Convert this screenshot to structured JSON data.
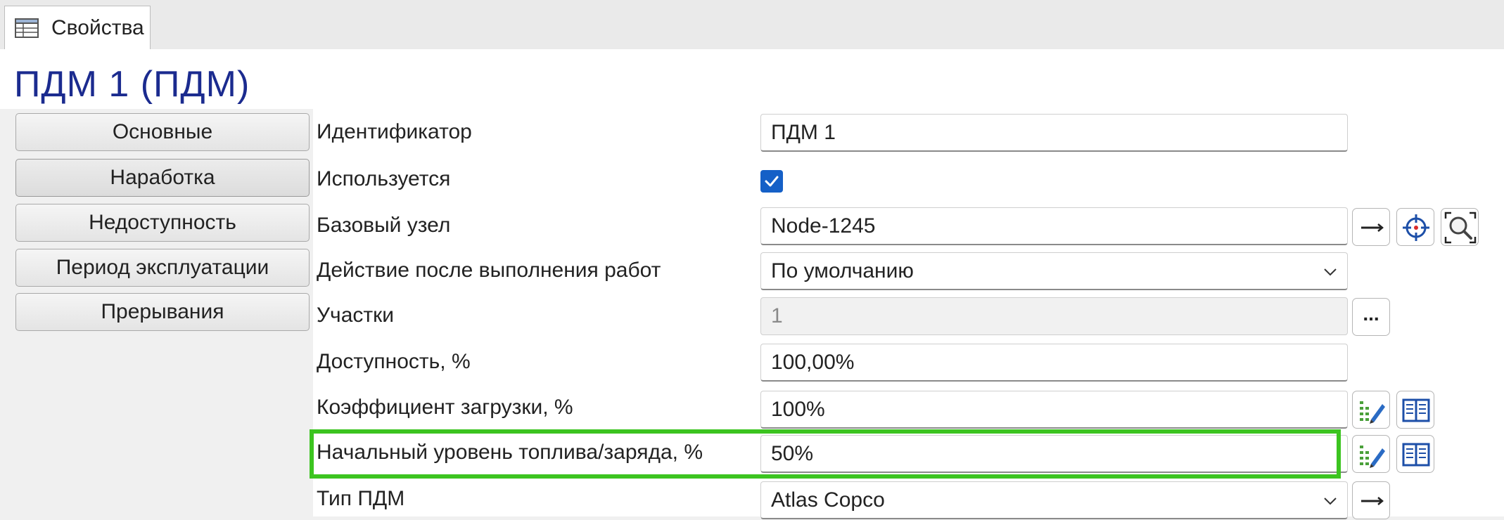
{
  "tab": {
    "label": "Свойства",
    "icon": "table-icon"
  },
  "page": {
    "title": "ПДМ 1 (ПДМ)"
  },
  "sidebar": {
    "items": [
      {
        "label": "Основные"
      },
      {
        "label": "Наработка"
      },
      {
        "label": "Недоступность"
      },
      {
        "label": "Период эксплуатации"
      },
      {
        "label": "Прерывания"
      }
    ]
  },
  "properties": {
    "identifier": {
      "label": "Идентификатор",
      "value": "ПДМ 1"
    },
    "used": {
      "label": "Используется",
      "checked": true
    },
    "base_node": {
      "label": "Базовый узел",
      "value": "Node-1245"
    },
    "action_after_work": {
      "label": "Действие после выполнения работ",
      "value": "По умолчанию"
    },
    "sections": {
      "label": "Участки",
      "value": "1",
      "button_label": "..."
    },
    "availability": {
      "label": "Доступность, %",
      "value": "100,00%"
    },
    "load_factor": {
      "label": "Коэффициент загрузки, %",
      "value": "100%"
    },
    "initial_fuel_level": {
      "label": "Начальный уровень топлива/заряда, %",
      "value": "50%"
    },
    "pdm_type": {
      "label": "Тип ПДМ",
      "value": "Atlas Copco"
    }
  },
  "colors": {
    "title": "#1b2b8f",
    "checkbox": "#1560c7",
    "highlight": "#3cc420"
  }
}
